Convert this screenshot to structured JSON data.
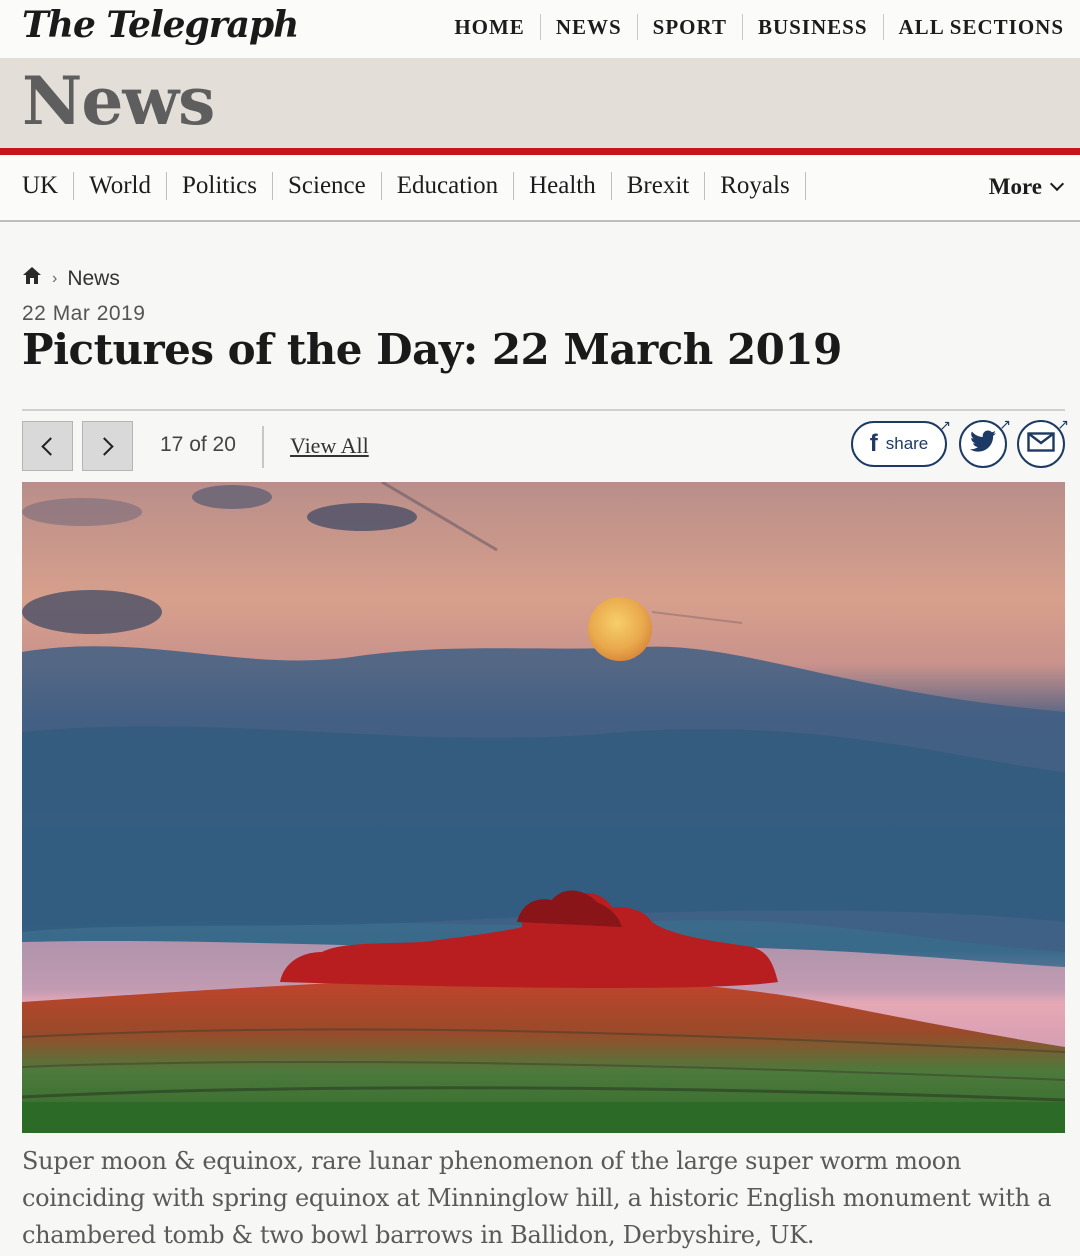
{
  "brand": {
    "name": "The Telegraph"
  },
  "topnav": [
    "HOME",
    "NEWS",
    "SPORT",
    "BUSINESS",
    "ALL SECTIONS"
  ],
  "section": {
    "title": "News"
  },
  "subnav": {
    "items": [
      "UK",
      "World",
      "Politics",
      "Science",
      "Education",
      "Health",
      "Brexit",
      "Royals"
    ],
    "more_label": "More"
  },
  "breadcrumb": {
    "home_icon": "home-icon",
    "current": "News"
  },
  "article": {
    "date": "22 Mar 2019",
    "headline": "Pictures of the Day: 22 March 2019"
  },
  "gallery": {
    "counter": "17 of 20",
    "view_all_label": "View All",
    "share_label": "share",
    "caption": "Super moon & equinox, rare lunar phenomenon of the large super worm moon coinciding with spring equinox at Minninglow hill, a historic English monument with a chambered tomb & two bowl barrows in Ballidon, Derbyshire, UK."
  },
  "colors": {
    "accent_red": "#c4161c",
    "share_blue": "#1c3a63",
    "section_band": "#e3ded8"
  },
  "icons": {
    "prev": "chevron-left-icon",
    "next": "chevron-right-icon",
    "facebook": "facebook-icon",
    "twitter": "twitter-icon",
    "email": "email-icon",
    "more": "chevron-down-icon"
  }
}
